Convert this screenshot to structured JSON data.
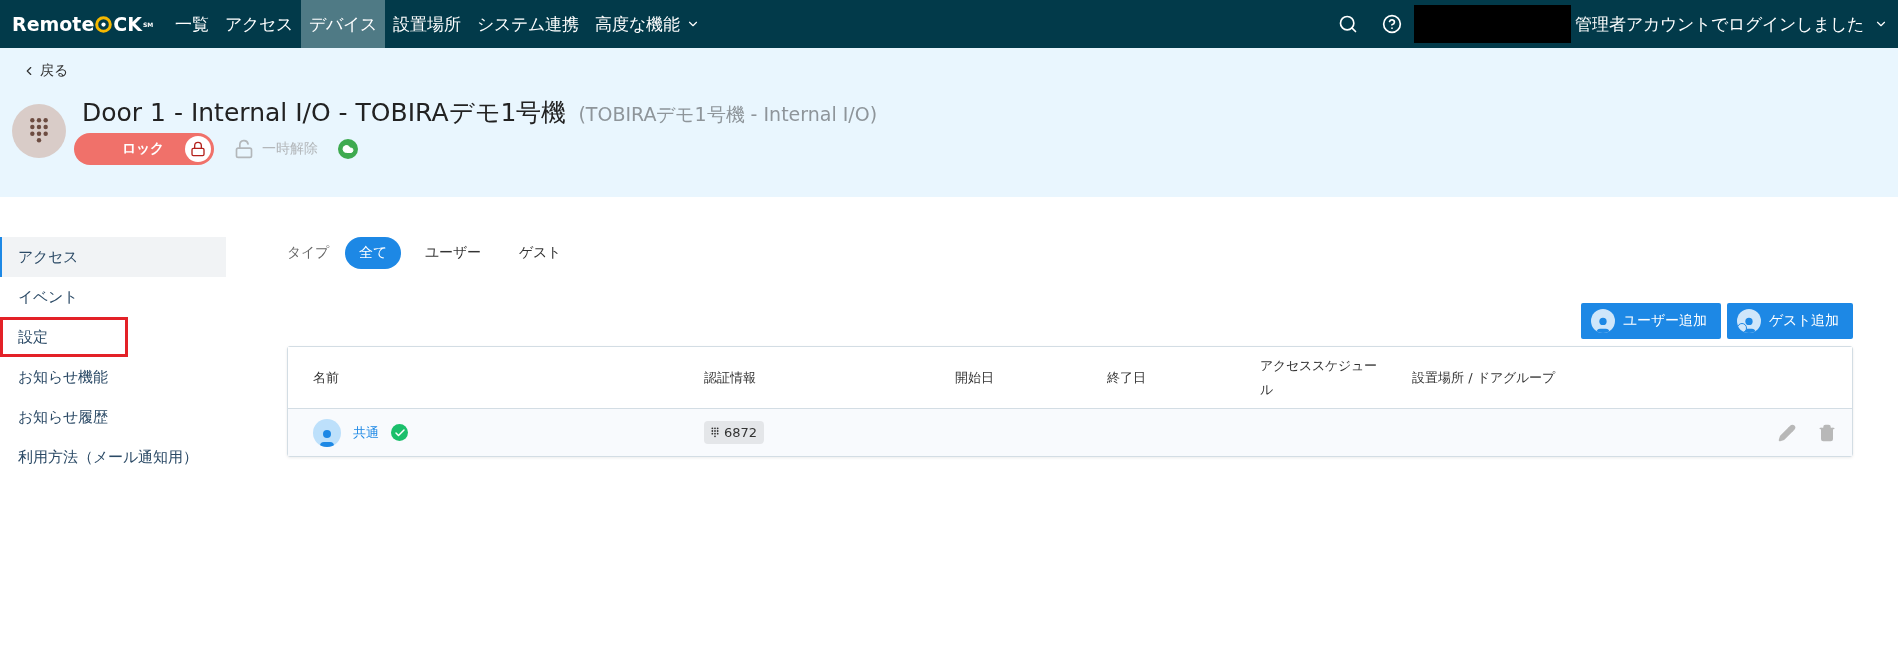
{
  "navbar": {
    "logo": {
      "text_before": "Remote",
      "text_after": "CK",
      "trademark": "SM"
    },
    "items": [
      {
        "label": "一覧",
        "selected": false
      },
      {
        "label": "アクセス",
        "selected": false
      },
      {
        "label": "デバイス",
        "selected": true
      },
      {
        "label": "設置場所",
        "selected": false
      },
      {
        "label": "システム連携",
        "selected": false
      },
      {
        "label": "高度な機能",
        "selected": false,
        "has_menu": true
      }
    ],
    "account": "管理者アカウントでログインしました"
  },
  "header": {
    "back": "戻る",
    "title": "Door 1 - Internal I/O - TOBIRAデモ1号機",
    "subtitle": "(TOBIRAデモ1号機 - Internal I/O)",
    "lock_button": "ロック",
    "unlock_button": "一時解除",
    "online": true
  },
  "sidebar": {
    "items": [
      {
        "label": "アクセス",
        "selected": true,
        "highlighted": false
      },
      {
        "label": "イベント",
        "selected": false,
        "highlighted": false
      },
      {
        "label": "設定",
        "selected": false,
        "highlighted": true
      },
      {
        "label": "お知らせ機能",
        "selected": false,
        "highlighted": false
      },
      {
        "label": "お知らせ履歴",
        "selected": false,
        "highlighted": false
      },
      {
        "label": "利用方法（メール通知用）",
        "selected": false,
        "highlighted": false
      }
    ]
  },
  "filter": {
    "label": "タイプ",
    "tabs": [
      {
        "label": "全て",
        "selected": true
      },
      {
        "label": "ユーザー",
        "selected": false
      },
      {
        "label": "ゲスト",
        "selected": false
      }
    ]
  },
  "actions": [
    {
      "label": "ユーザー追加",
      "kind": "user"
    },
    {
      "label": "ゲスト追加",
      "kind": "guest"
    }
  ],
  "table": {
    "columns": [
      "名前",
      "認証情報",
      "開始日",
      "終了日",
      "アクセススケジュール",
      "設置場所 / ドアグループ"
    ],
    "rows": [
      {
        "name": "共通",
        "active": true,
        "credential": "6872"
      }
    ]
  }
}
